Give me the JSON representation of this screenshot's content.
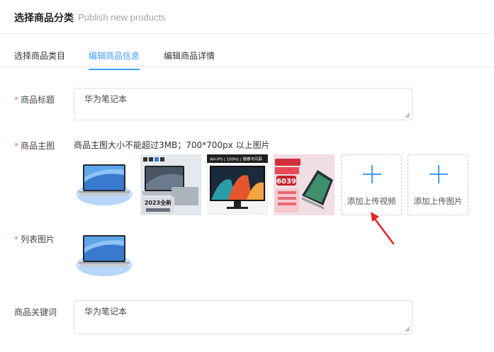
{
  "header": {
    "title": "选择商品分类",
    "subtitle": "Publish new products"
  },
  "tabs": [
    {
      "label": "选择商品类目",
      "active": false
    },
    {
      "label": "编辑商品信息",
      "active": true
    },
    {
      "label": "编辑商品详情",
      "active": false
    }
  ],
  "form": {
    "required_mark": "*",
    "title": {
      "label": "商品标题",
      "value": "华为笔记本"
    },
    "main_images": {
      "label": "商品主图",
      "hint": "商品主图大小不能超过3MB；700*700px 以上图片",
      "thumb_texts": {
        "thumb2": "2023全新",
        "thumb3": "AH-IPS | 100Hz | 爆暴不闪屏",
        "thumb4": "6039"
      },
      "upload_video": "添加上传视频",
      "upload_image": "添加上传图片"
    },
    "list_image": {
      "label": "列表图片"
    },
    "keywords": {
      "label": "商品关键词",
      "value": "华为笔记本"
    }
  },
  "colors": {
    "accent": "#409eff",
    "required": "#f56c6c",
    "arrow": "#e8262a"
  }
}
